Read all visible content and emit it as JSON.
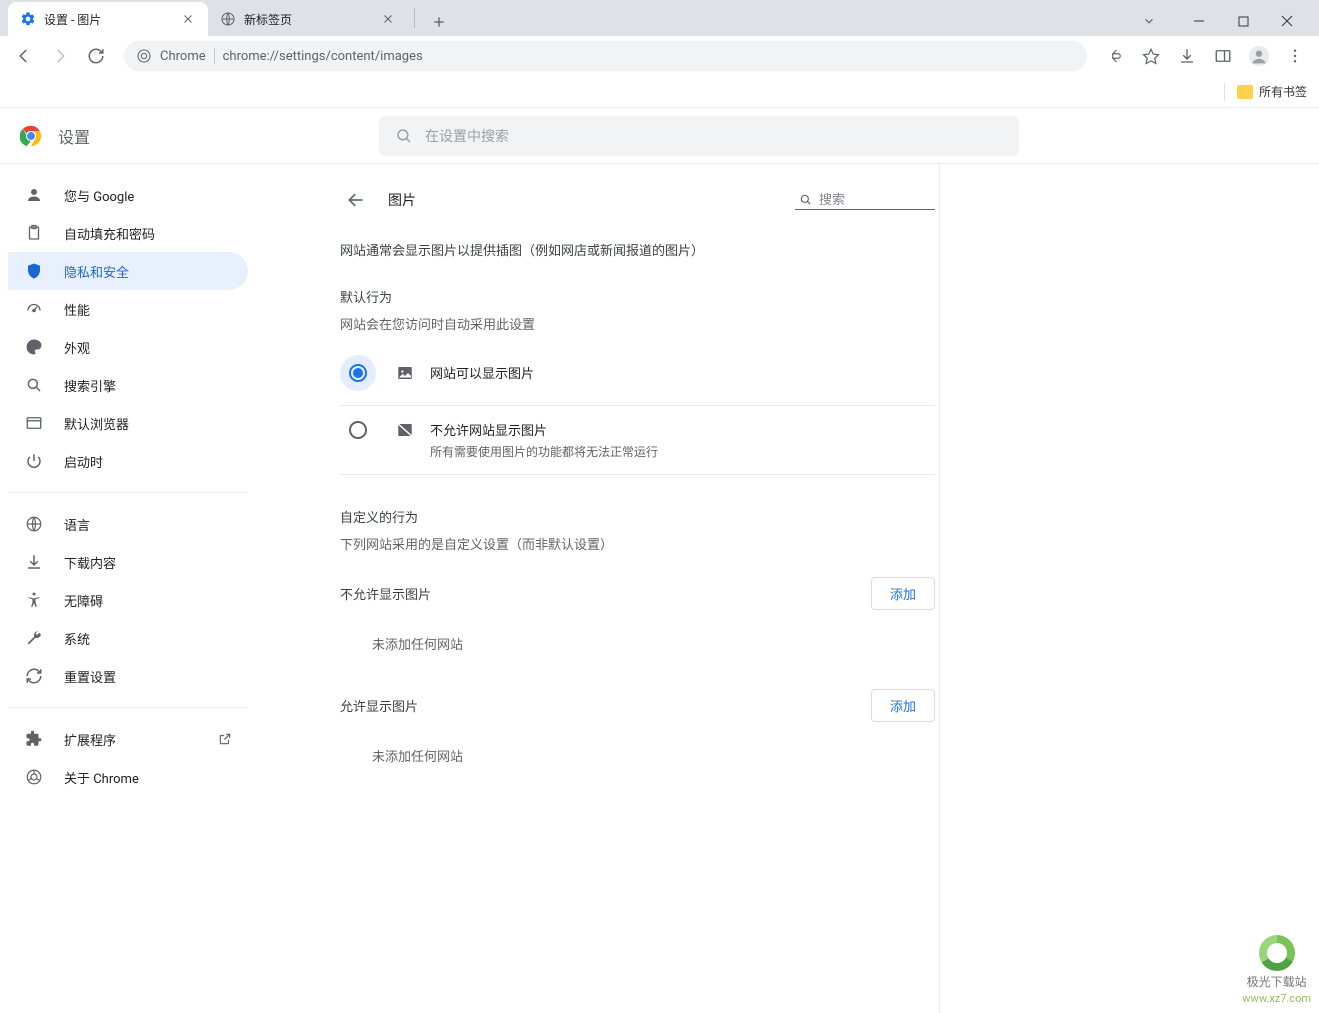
{
  "browser": {
    "tabs": [
      {
        "title": "设置 - 图片",
        "active": true,
        "icon": "gear"
      },
      {
        "title": "新标签页",
        "active": false,
        "icon": "globe"
      }
    ],
    "address_label": "Chrome",
    "url": "chrome://settings/content/images",
    "bookmark_all": "所有书签"
  },
  "settings_header": {
    "title": "设置",
    "search_placeholder": "在设置中搜索"
  },
  "sidebar": {
    "items_top": [
      {
        "label": "您与 Google",
        "icon": "person"
      },
      {
        "label": "自动填充和密码",
        "icon": "clipboard"
      },
      {
        "label": "隐私和安全",
        "icon": "shield",
        "active": true
      },
      {
        "label": "性能",
        "icon": "speed"
      },
      {
        "label": "外观",
        "icon": "palette"
      },
      {
        "label": "搜索引擎",
        "icon": "search"
      },
      {
        "label": "默认浏览器",
        "icon": "browser"
      },
      {
        "label": "启动时",
        "icon": "power"
      }
    ],
    "items_mid": [
      {
        "label": "语言",
        "icon": "globe"
      },
      {
        "label": "下载内容",
        "icon": "download"
      },
      {
        "label": "无障碍",
        "icon": "accessibility"
      },
      {
        "label": "系统",
        "icon": "wrench"
      },
      {
        "label": "重置设置",
        "icon": "refresh"
      }
    ],
    "items_bottom": [
      {
        "label": "扩展程序",
        "icon": "extension",
        "external": true
      },
      {
        "label": "关于 Chrome",
        "icon": "chrome"
      }
    ]
  },
  "page": {
    "title": "图片",
    "search_placeholder": "搜索",
    "description": "网站通常会显示图片以提供插图（例如网店或新闻报道的图片）",
    "default_behavior_label": "默认行为",
    "default_behavior_sub": "网站会在您访问时自动采用此设置",
    "options": [
      {
        "title": "网站可以显示图片",
        "desc": "",
        "selected": true,
        "icon": "image"
      },
      {
        "title": "不允许网站显示图片",
        "desc": "所有需要使用图片的功能都将无法正常运行",
        "selected": false,
        "icon": "image-off"
      }
    ],
    "custom_label": "自定义的行为",
    "custom_sub": "下列网站采用的是自定义设置（而非默认设置）",
    "blocked_section": "不允许显示图片",
    "allowed_section": "允许显示图片",
    "add_button": "添加",
    "empty_message": "未添加任何网站"
  },
  "watermark": {
    "text": "极光下载站",
    "url": "www.xz7.com"
  }
}
